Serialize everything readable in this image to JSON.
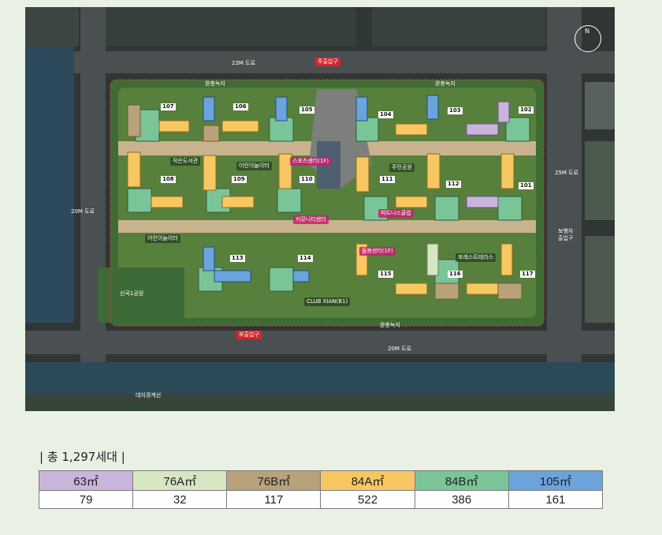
{
  "map": {
    "roads": {
      "north": "23M 도로",
      "south": "20M 도로",
      "east": "25M 도로",
      "west": "20M 도로"
    },
    "greens": {
      "north_left": "완충녹지",
      "north_right": "완충녹지",
      "south": "완충녹지"
    },
    "park": "신곡1공원",
    "bottom_label": "대지경계선",
    "gates": {
      "main": "주출입구",
      "sub": "부출입구",
      "pedestrian": "보행자\n출입구"
    },
    "buildings": [
      "107",
      "106",
      "105",
      "104",
      "103",
      "102",
      "108",
      "109",
      "110",
      "111",
      "112",
      "101",
      "113",
      "114",
      "115",
      "116",
      "117"
    ],
    "facilities": {
      "f1": "작은도서관",
      "f2": "주민공원",
      "f3": "어린이놀이터",
      "f4": "스포츠센터(1F)",
      "f5": "커뮤니티센터",
      "f6": "피트니스클럽",
      "f7": "돌봄센터(1F)",
      "f8": "어린이놀이터",
      "f9": "CLUB XIAN(B1)",
      "f10": "포레스트테라스"
    },
    "compass": "N"
  },
  "summary": "| 총 1,297세대 |",
  "unit_table": {
    "headers": [
      "63㎡",
      "76A㎡",
      "76B㎡",
      "84A㎡",
      "84B㎡",
      "105㎡"
    ],
    "values": [
      "79",
      "32",
      "117",
      "522",
      "386",
      "161"
    ],
    "header_colors": [
      "#c9b4dc",
      "#d7e6c2",
      "#b8a27a",
      "#f7c861",
      "#79c598",
      "#6ba4dc"
    ]
  }
}
